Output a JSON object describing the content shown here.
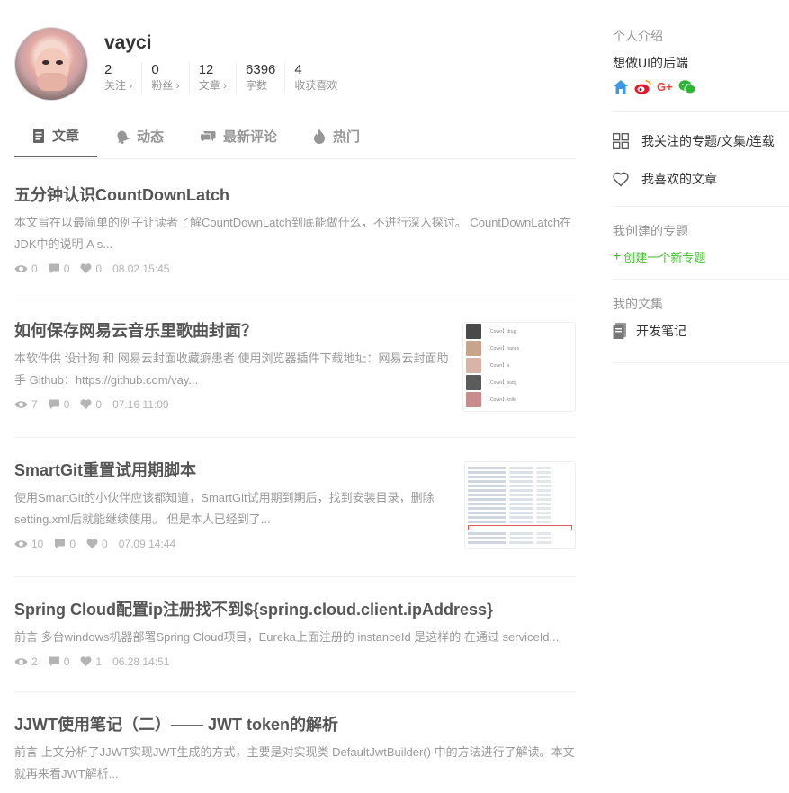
{
  "profile": {
    "name": "vayci",
    "stats": [
      {
        "num": "2",
        "label": "关注 ›"
      },
      {
        "num": "0",
        "label": "粉丝 ›"
      },
      {
        "num": "12",
        "label": "文章 ›"
      },
      {
        "num": "6396",
        "label": "字数"
      },
      {
        "num": "4",
        "label": "收获喜欢"
      }
    ]
  },
  "tabs": [
    {
      "label": "文章",
      "icon": "document-icon",
      "active": true
    },
    {
      "label": "动态",
      "icon": "bell-icon"
    },
    {
      "label": "最新评论",
      "icon": "comments-icon"
    },
    {
      "label": "热门",
      "icon": "fire-icon"
    }
  ],
  "articles": [
    {
      "title": "五分钟认识CountDownLatch",
      "abstract": "本文旨在以最简单的例子让读者了解CountDownLatch到底能做什么，不进行深入探讨。 CountDownLatch在JDK中的说明 A s...",
      "views": "0",
      "comments": "0",
      "likes": "0",
      "date": "08.02 15:45"
    },
    {
      "title": "如何保存网易云音乐里歌曲封面？",
      "abstract": "本软件供 设计狗 和 网易云封面收藏癖患者 使用浏览器插件下载地址：网易云封面助手 Github：https://github.com/vay...",
      "views": "7",
      "comments": "0",
      "likes": "0",
      "date": "07.16 11:09",
      "thumb_items": [
        "【Cover】drug",
        "【Cover】hands",
        "【Cover】a",
        "【Cover】body",
        "【Cover】knife"
      ]
    },
    {
      "title": "SmartGit重置试用期脚本",
      "abstract": "使用SmartGit的小伙伴应该都知道，SmartGit试用期到期后，找到安装目录，删除setting.xml后就能继续使用。 但是本人已经到了...",
      "views": "10",
      "comments": "0",
      "likes": "0",
      "date": "07.09 14:44"
    },
    {
      "title": "Spring Cloud配置ip注册找不到${spring.cloud.client.ipAddress}",
      "abstract": "前言 多台windows机器部署Spring Cloud项目，Eureka上面注册的 instanceId 是这样的 在通过 serviceId...",
      "views": "2",
      "comments": "0",
      "likes": "1",
      "date": "06.28 14:51"
    },
    {
      "title": "JJWT使用笔记（二）—— JWT token的解析",
      "abstract": "前言 上文分析了JJWT实现JWT生成的方式，主要是对实现类 DefaultJwtBuilder() 中的方法进行了解读。本文就再来看JWT解析..."
    }
  ],
  "sidebar": {
    "intro_title": "个人介绍",
    "intro_text": "想做UI的后端",
    "social_icons": [
      "home-icon",
      "weibo-icon",
      "google-plus-icon",
      "wechat-icon"
    ],
    "social_gplus": "G+",
    "following_label": "我关注的专题/文集/连载",
    "liked_label": "我喜欢的文章",
    "created_title": "我创建的专题",
    "create_new": "创建一个新专题",
    "collections_title": "我的文集",
    "collection_name": "开发笔记"
  },
  "colors": {
    "accent_green": "#42c02e",
    "text_gray": "#969696"
  }
}
